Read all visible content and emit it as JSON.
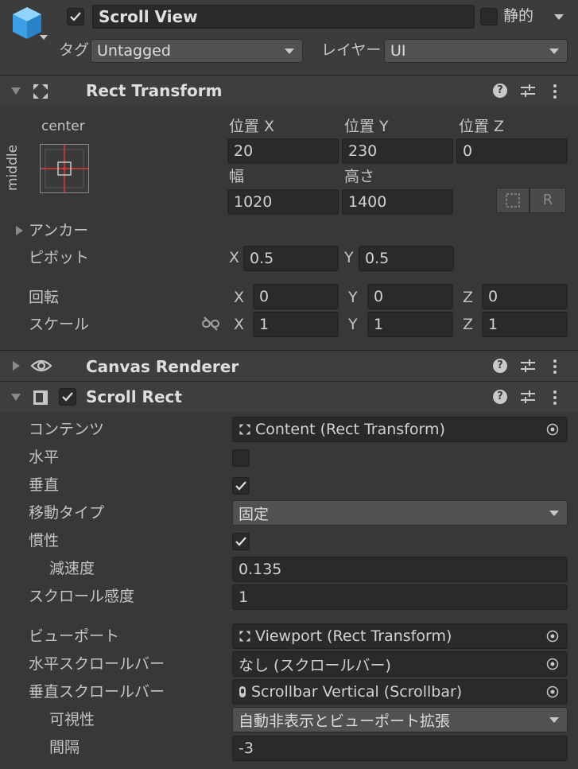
{
  "header": {
    "object_name": "Scroll View",
    "active": true,
    "static_label": "静的",
    "static_checked": false,
    "tag_label": "タグ",
    "tag_value": "Untagged",
    "layer_label": "レイヤー",
    "layer_value": "UI"
  },
  "rect_transform": {
    "title": "Rect Transform",
    "anchor_h": "center",
    "anchor_v": "middle",
    "pos_x_label": "位置 X",
    "pos_y_label": "位置 Y",
    "pos_z_label": "位置 Z",
    "pos_x": "20",
    "pos_y": "230",
    "pos_z": "0",
    "width_label": "幅",
    "height_label": "高さ",
    "width": "1020",
    "height": "1400",
    "raw_button": "R",
    "anchors_label": "アンカー",
    "pivot_label": "ピボット",
    "pivot_x_label": "X",
    "pivot_y_label": "Y",
    "pivot_x": "0.5",
    "pivot_y": "0.5",
    "rotation_label": "回転",
    "rot_x": "0",
    "rot_y": "0",
    "rot_z": "0",
    "scale_label": "スケール",
    "scale_x": "1",
    "scale_y": "1",
    "scale_z": "1",
    "x_label": "X",
    "y_label": "Y",
    "z_label": "Z"
  },
  "canvas_renderer": {
    "title": "Canvas Renderer"
  },
  "scroll_rect": {
    "title": "Scroll Rect",
    "enabled": true,
    "content_label": "コンテンツ",
    "content_value": "Content (Rect Transform)",
    "horizontal_label": "水平",
    "horizontal_checked": false,
    "vertical_label": "垂直",
    "vertical_checked": true,
    "movement_label": "移動タイプ",
    "movement_value": "固定",
    "inertia_label": "慣性",
    "inertia_checked": true,
    "deceleration_label": "減速度",
    "deceleration_value": "0.135",
    "sensitivity_label": "スクロール感度",
    "sensitivity_value": "1",
    "viewport_label": "ビューポート",
    "viewport_value": "Viewport (Rect Transform)",
    "hscroll_label": "水平スクロールバー",
    "hscroll_value": "なし (スクロールバー)",
    "vscroll_label": "垂直スクロールバー",
    "vscroll_value": "Scrollbar Vertical (Scrollbar)",
    "visibility_label": "可視性",
    "visibility_value": "自動非表示とビューポート拡張",
    "spacing_label": "間隔",
    "spacing_value": "-3"
  },
  "colors": {
    "background": "#383838",
    "field": "#2a2a2a",
    "dropdown": "#515151",
    "anchor_red": "#e03a3a"
  }
}
